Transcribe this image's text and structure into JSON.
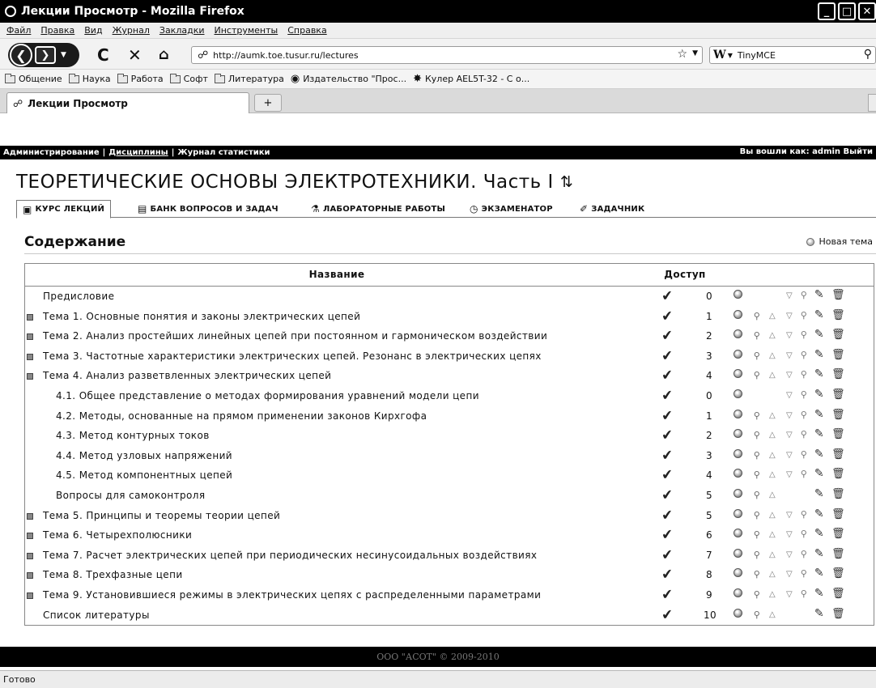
{
  "window": {
    "title": "Лекции Просмотр - Mozilla Firefox",
    "min": "_",
    "max": "□",
    "close": "✕"
  },
  "menu": [
    "Файл",
    "Правка",
    "Вид",
    "Журнал",
    "Закладки",
    "Инструменты",
    "Справка"
  ],
  "nav": {
    "url": "http://aumk.toe.tusur.ru/lectures",
    "search_engine": "W",
    "search_value": "TinyMCE"
  },
  "bookmarks": [
    {
      "label": "Общение",
      "icon": "folder-icon"
    },
    {
      "label": "Наука",
      "icon": "folder-icon"
    },
    {
      "label": "Работа",
      "icon": "folder-icon"
    },
    {
      "label": "Софт",
      "icon": "folder-icon"
    },
    {
      "label": "Литература",
      "icon": "folder-icon"
    },
    {
      "label": "Издательство \"Прос...",
      "icon": "site-icon"
    },
    {
      "label": "Кулер AEL5T-32 - С о...",
      "icon": "site-icon"
    }
  ],
  "tab": {
    "label": "Лекции Просмотр",
    "new_tab": "+"
  },
  "admin": {
    "administration": "Администрирование",
    "disciplines": "Дисциплины",
    "stats": "Журнал статистики",
    "sep": "|",
    "logged_in": "Вы вошли как: admin",
    "logout": "Выйти"
  },
  "page": {
    "title": "ТЕОРЕТИЧЕСКИЕ ОСНОВЫ ЭЛЕКТРОТЕХНИКИ. Часть I"
  },
  "subtabs": [
    "КУРС ЛЕКЦИЙ",
    "БАНК ВОПРОСОВ И ЗАДАЧ",
    "ЛАБОРАТОРНЫЕ РАБОТЫ",
    "ЭКЗАМЕНАТОР",
    "ЗАДАЧНИК"
  ],
  "content": {
    "heading": "Содержание",
    "new_theme": "Новая тема"
  },
  "table": {
    "headers": {
      "name": "Название",
      "access": "Доступ"
    },
    "rows": [
      {
        "name": "Предисловие",
        "num": "0",
        "bullet": false,
        "level": 0,
        "lock": false,
        "up": false,
        "down": true,
        "shield": true
      },
      {
        "name": "Тема 1. Основные понятия и законы электрических цепей",
        "num": "1",
        "bullet": true,
        "level": 0,
        "lock": true,
        "up": true,
        "down": true,
        "shield": true
      },
      {
        "name": "Тема 2. Анализ простейших линейных цепей при постоянном и гармоническом воздействии",
        "num": "2",
        "bullet": true,
        "level": 0,
        "lock": true,
        "up": true,
        "down": true,
        "shield": true
      },
      {
        "name": "Тема 3. Частотные характеристики электрических цепей. Резонанс в электрических цепях",
        "num": "3",
        "bullet": true,
        "level": 0,
        "lock": true,
        "up": true,
        "down": true,
        "shield": true
      },
      {
        "name": "Тема 4. Анализ разветвленных электрических цепей",
        "num": "4",
        "bullet": true,
        "level": 0,
        "lock": true,
        "up": true,
        "down": true,
        "shield": true
      },
      {
        "name": "4.1. Общее представление о методах формирования уравнений модели цепи",
        "num": "0",
        "bullet": false,
        "level": 1,
        "lock": false,
        "up": false,
        "down": true,
        "shield": true
      },
      {
        "name": "4.2. Методы, основанные на прямом применении законов Кирхгофа",
        "num": "1",
        "bullet": false,
        "level": 1,
        "lock": true,
        "up": true,
        "down": true,
        "shield": true
      },
      {
        "name": "4.3. Метод контурных токов",
        "num": "2",
        "bullet": false,
        "level": 1,
        "lock": true,
        "up": true,
        "down": true,
        "shield": true
      },
      {
        "name": "4.4. Метод узловых напряжений",
        "num": "3",
        "bullet": false,
        "level": 1,
        "lock": true,
        "up": true,
        "down": true,
        "shield": true
      },
      {
        "name": "4.5. Метод компонентных цепей",
        "num": "4",
        "bullet": false,
        "level": 1,
        "lock": true,
        "up": true,
        "down": true,
        "shield": true
      },
      {
        "name": "Вопросы для самоконтроля",
        "num": "5",
        "bullet": false,
        "level": 1,
        "lock": true,
        "up": true,
        "down": false,
        "shield": false
      },
      {
        "name": "Тема 5. Принципы и теоремы теории цепей",
        "num": "5",
        "bullet": true,
        "level": 0,
        "lock": true,
        "up": true,
        "down": true,
        "shield": true
      },
      {
        "name": "Тема 6. Четырехполюсники",
        "num": "6",
        "bullet": true,
        "level": 0,
        "lock": true,
        "up": true,
        "down": true,
        "shield": true
      },
      {
        "name": "Тема 7. Расчет электрических цепей при периодических несинусоидальных воздействиях",
        "num": "7",
        "bullet": true,
        "level": 0,
        "lock": true,
        "up": true,
        "down": true,
        "shield": true
      },
      {
        "name": "Тема 8. Трехфазные цепи",
        "num": "8",
        "bullet": true,
        "level": 0,
        "lock": true,
        "up": true,
        "down": true,
        "shield": true
      },
      {
        "name": "Тема 9. Установившиеся режимы в электрических цепях с распределенными параметрами",
        "num": "9",
        "bullet": true,
        "level": 0,
        "lock": true,
        "up": true,
        "down": true,
        "shield": true
      },
      {
        "name": "Список литературы",
        "num": "10",
        "bullet": false,
        "level": 0,
        "lock": true,
        "up": true,
        "down": false,
        "shield": false
      }
    ]
  },
  "footer": {
    "copyright": "ООО \"АСОТ\" © 2009-2010"
  },
  "status": {
    "text": "Готово"
  }
}
